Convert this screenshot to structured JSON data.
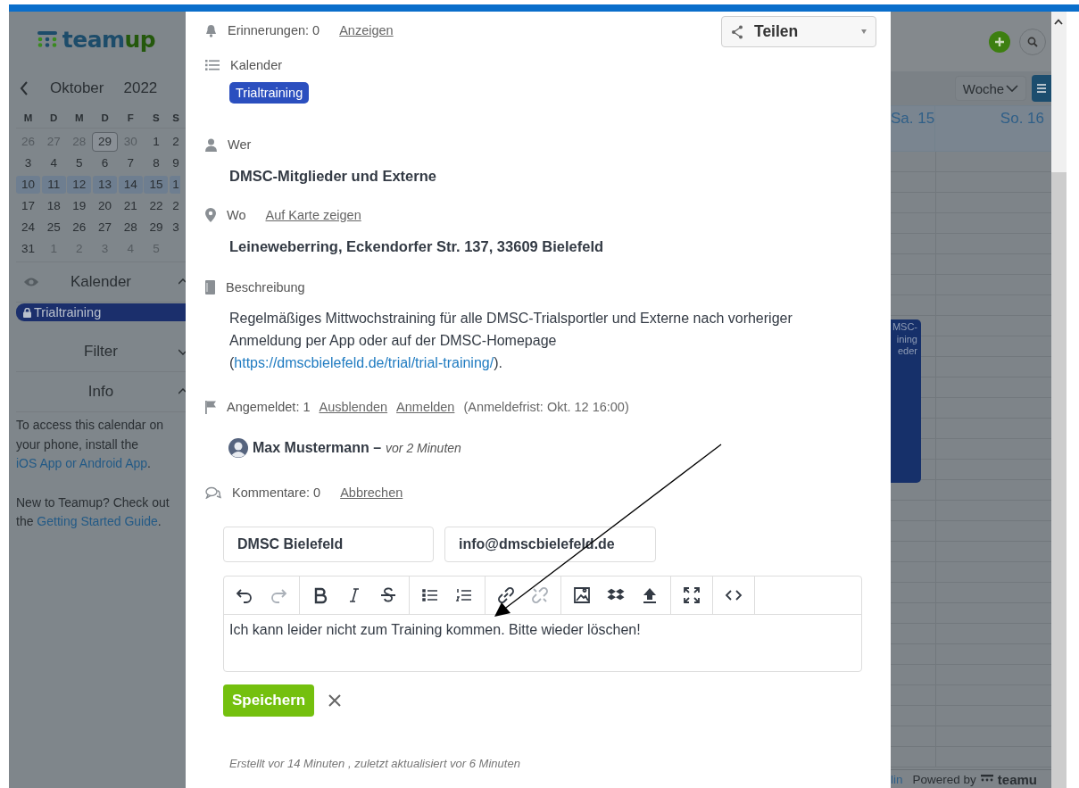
{
  "sidebar": {
    "logo": {
      "part_1": "team",
      "part_2": "up"
    },
    "month": "Oktober",
    "year": "2022",
    "weekdays": [
      "M",
      "D",
      "M",
      "D",
      "F",
      "S",
      "S"
    ],
    "weeks": [
      {
        "selected": false,
        "days": [
          {
            "label": "26",
            "muted": true,
            "today": false
          },
          {
            "label": "27",
            "muted": true,
            "today": false
          },
          {
            "label": "28",
            "muted": true,
            "today": false
          },
          {
            "label": "29",
            "muted": false,
            "today": true
          },
          {
            "label": "30",
            "muted": true,
            "today": false
          },
          {
            "label": "1",
            "muted": false,
            "today": false
          },
          {
            "label": "2",
            "muted": false,
            "today": false
          }
        ]
      },
      {
        "selected": false,
        "days": [
          {
            "label": "3",
            "muted": false,
            "today": false
          },
          {
            "label": "4",
            "muted": false,
            "today": false
          },
          {
            "label": "5",
            "muted": false,
            "today": false
          },
          {
            "label": "6",
            "muted": false,
            "today": false
          },
          {
            "label": "7",
            "muted": false,
            "today": false
          },
          {
            "label": "8",
            "muted": false,
            "today": false
          },
          {
            "label": "9",
            "muted": false,
            "today": false
          }
        ]
      },
      {
        "selected": true,
        "days": [
          {
            "label": "10",
            "muted": false,
            "today": false
          },
          {
            "label": "11",
            "muted": false,
            "today": false
          },
          {
            "label": "12",
            "muted": false,
            "today": false
          },
          {
            "label": "13",
            "muted": false,
            "today": false
          },
          {
            "label": "14",
            "muted": false,
            "today": false
          },
          {
            "label": "15",
            "muted": false,
            "today": false
          },
          {
            "label": "1",
            "muted": false,
            "today": false
          }
        ]
      },
      {
        "selected": false,
        "days": [
          {
            "label": "17",
            "muted": false,
            "today": false
          },
          {
            "label": "18",
            "muted": false,
            "today": false
          },
          {
            "label": "19",
            "muted": false,
            "today": false
          },
          {
            "label": "20",
            "muted": false,
            "today": false
          },
          {
            "label": "21",
            "muted": false,
            "today": false
          },
          {
            "label": "22",
            "muted": false,
            "today": false
          },
          {
            "label": "2",
            "muted": false,
            "today": false
          }
        ]
      },
      {
        "selected": false,
        "days": [
          {
            "label": "24",
            "muted": false,
            "today": false
          },
          {
            "label": "25",
            "muted": false,
            "today": false
          },
          {
            "label": "26",
            "muted": false,
            "today": false
          },
          {
            "label": "27",
            "muted": false,
            "today": false
          },
          {
            "label": "28",
            "muted": false,
            "today": false
          },
          {
            "label": "29",
            "muted": false,
            "today": false
          },
          {
            "label": "3",
            "muted": false,
            "today": false
          }
        ]
      },
      {
        "selected": false,
        "days": [
          {
            "label": "31",
            "muted": false,
            "today": false
          },
          {
            "label": "1",
            "muted": true,
            "today": false
          },
          {
            "label": "2",
            "muted": true,
            "today": false
          },
          {
            "label": "3",
            "muted": true,
            "today": false
          },
          {
            "label": "4",
            "muted": true,
            "today": false
          },
          {
            "label": "5",
            "muted": true,
            "today": false
          }
        ]
      }
    ],
    "sections": [
      {
        "kind": "calendars",
        "title": "Kalender",
        "expanded": true,
        "calendars": [
          {
            "name": "Trialtraining",
            "color": "#1b2f6c"
          }
        ]
      },
      {
        "kind": "filter",
        "title": "Filter",
        "expanded": false
      },
      {
        "kind": "info",
        "title": "Info",
        "expanded": true,
        "paragraphs": [
          [
            {
              "text": "To access this calendar on your phone, install the "
            },
            {
              "link": "iOS App or Android App"
            },
            {
              "text": "."
            }
          ],
          [
            {
              "text": "New to Teamup? Check out the "
            },
            {
              "link": "Getting Started Guide"
            },
            {
              "text": "."
            }
          ]
        ]
      }
    ]
  },
  "event": {
    "reminders": {
      "label": "Erinnerungen: 0",
      "link": "Anzeigen"
    },
    "share_button": "Teilen",
    "calendar": {
      "label": "Kalender",
      "chip": "Trialtraining",
      "color": "#2b4fbf"
    },
    "who": {
      "label": "Wer",
      "value": "DMSC-Mitglieder und Externe"
    },
    "where": {
      "label": "Wo",
      "link": "Auf Karte zeigen",
      "value": "Leineweberring, Eckendorfer Str. 137, 33609 Bielefeld"
    },
    "description": {
      "label": "Beschreibung",
      "parts": [
        {
          "text": "Regelmäßiges Mittwochstraining für alle DMSC-Trialsportler und Externe nach vorheriger Anmeldung per App oder auf der DMSC-Homepage ("
        },
        {
          "link": "https://dmscbielefeld.de/trial/trial-training/"
        },
        {
          "text": ")."
        }
      ]
    },
    "signups": {
      "label": "Angemeldet: 1",
      "links": [
        "Ausblenden",
        "Anmelden"
      ],
      "deadline": "(Anmeldefrist: Okt. 12 16:00)"
    },
    "attendees": [
      {
        "name": "Max Mustermann –",
        "time": "vor 2 Minuten"
      }
    ],
    "comments": {
      "label": "Kommentare: 0",
      "link": "Abbrechen"
    },
    "comment_form": {
      "name_value": "DMSC Bielefeld",
      "email_value": "info@dmscbielefeld.de",
      "toolbar_groups": [
        [
          {
            "disabled": false
          },
          {
            "disabled": true
          }
        ],
        [
          {
            "disabled": false
          },
          {
            "disabled": false
          },
          {
            "disabled": false
          }
        ],
        [
          {
            "disabled": false
          },
          {
            "disabled": false
          }
        ],
        [
          {
            "disabled": false
          },
          {
            "disabled": true
          }
        ],
        [
          {
            "disabled": false
          },
          {
            "disabled": false
          },
          {
            "disabled": false
          }
        ],
        [
          {
            "disabled": false
          }
        ],
        [
          {
            "disabled": false
          }
        ]
      ],
      "text": "Ich kann leider nicht zum Training kommen. Bitte wieder löschen!",
      "save_button": "Speichern"
    },
    "footer": "Erstellt vor 14 Minuten , zuletzt aktualisiert vor 6 Minuten"
  },
  "calendar_view": {
    "view_select": "Woche",
    "day_headers": [
      "Sa. 15",
      "So. 16"
    ],
    "event_lines": [
      "MSC-",
      "ining",
      "eder"
    ],
    "footer": {
      "link": "lin",
      "powered": "Powered by",
      "logo": "teamu"
    }
  }
}
